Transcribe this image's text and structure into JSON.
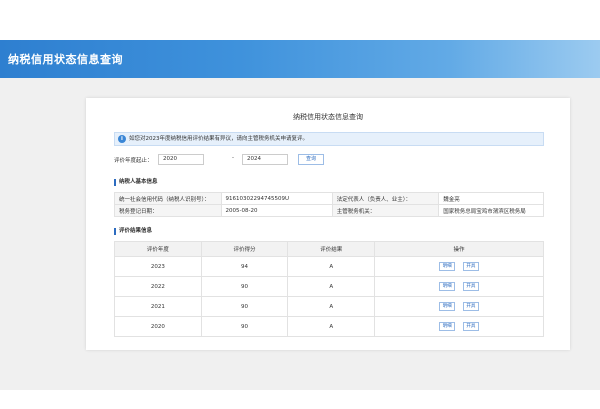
{
  "header": {
    "title": "纳税信用状态信息查询"
  },
  "panel": {
    "title": "纳税信用状态信息查询",
    "notice": "如您对2023年度纳税信用评价结果有异议，请向主管税务机关申请复评。",
    "notice_icon": "info-icon"
  },
  "filter": {
    "label": "评价年度起止：",
    "start_year": "2020",
    "separator": "-",
    "end_year": "2024",
    "query_label": "查询"
  },
  "basic_info": {
    "title": "纳税人基本信息",
    "rows": [
      {
        "k1": "统一社会信用代码（纳税人识别号）：",
        "v1": "91610302294745509U",
        "k2": "法定代表人（负责人、业主）：",
        "v2": "魏金亮"
      },
      {
        "k1": "税务登记日期：",
        "v1": "2005-08-20",
        "k2": "主管税务机关：",
        "v2": "国家税务总局宝鸡市渭滨区税务局"
      }
    ]
  },
  "evaluation": {
    "title": "评价结果信息",
    "headers": [
      "评价年度",
      "评价得分",
      "评价结果",
      "操作"
    ],
    "rows": [
      {
        "year": "2023",
        "score": "94",
        "result": "A"
      },
      {
        "year": "2022",
        "score": "90",
        "result": "A"
      },
      {
        "year": "2021",
        "score": "90",
        "result": "A"
      },
      {
        "year": "2020",
        "score": "90",
        "result": "A"
      }
    ],
    "action_view": "明细",
    "action_print": "开具"
  }
}
